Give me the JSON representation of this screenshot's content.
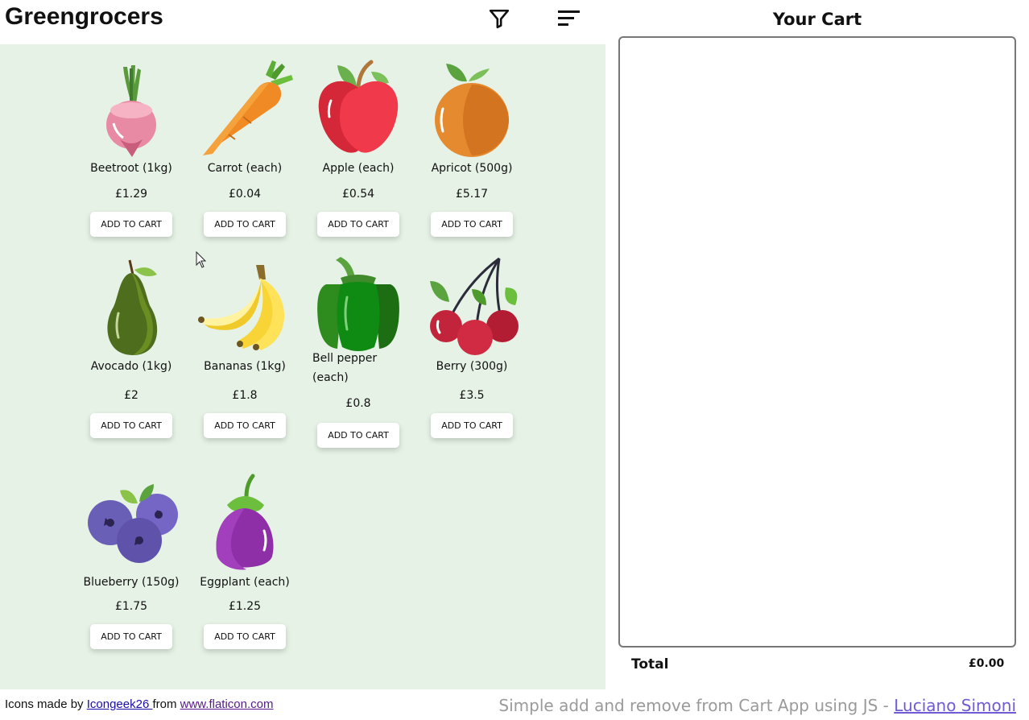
{
  "header": {
    "title": "Greengrocers",
    "filter_icon": "filter-icon",
    "sort_icon": "sort-icon"
  },
  "products": [
    {
      "name": "Beetroot (1kg)",
      "price": "£1.29",
      "button": "ADD TO CART",
      "icon": "beetroot-icon"
    },
    {
      "name": "Carrot (each)",
      "price": "£0.04",
      "button": "ADD TO CART",
      "icon": "carrot-icon"
    },
    {
      "name": "Apple (each)",
      "price": "£0.54",
      "button": "ADD TO CART",
      "icon": "apple-icon"
    },
    {
      "name": "Apricot (500g)",
      "price": "£5.17",
      "button": "ADD TO CART",
      "icon": "apricot-icon"
    },
    {
      "name": "Avocado (1kg)",
      "price": "£2",
      "button": "ADD TO CART",
      "icon": "avocado-icon"
    },
    {
      "name": "Bananas (1kg)",
      "price": "£1.8",
      "button": "ADD TO CART",
      "icon": "bananas-icon"
    },
    {
      "name": "Bell pepper (each)",
      "price": "£0.8",
      "button": "ADD TO CART",
      "icon": "bell-pepper-icon"
    },
    {
      "name": "Berry (300g)",
      "price": "£3.5",
      "button": "ADD TO CART",
      "icon": "berry-icon"
    },
    {
      "name": "Blueberry (150g)",
      "price": "£1.75",
      "button": "ADD TO CART",
      "icon": "blueberry-icon"
    },
    {
      "name": "Eggplant (each)",
      "price": "£1.25",
      "button": "ADD TO CART",
      "icon": "eggplant-icon"
    }
  ],
  "cart": {
    "title": "Your Cart",
    "total_label": "Total",
    "total_value": "£0.00"
  },
  "footer": {
    "credit_prefix": "Icons made by ",
    "credit_author": "Icongeek26 ",
    "credit_middle": "from ",
    "credit_site": "www.flaticon.com",
    "right_text": "Simple add and remove from Cart App using JS - ",
    "right_author": "Luciano Simoni"
  }
}
